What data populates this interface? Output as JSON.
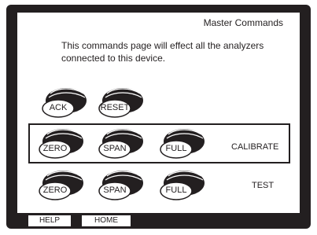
{
  "screen": {
    "title": "Master Commands",
    "description": "This commands page will effect all the analyzers connected to this device."
  },
  "buttons": {
    "ack": "ACK",
    "reset": "RESET",
    "calibrate": {
      "zero": "ZERO",
      "span": "SPAN",
      "full": "FULL",
      "label": "CALIBRATE"
    },
    "test": {
      "zero": "ZERO",
      "span": "SPAN",
      "full": "FULL",
      "label": "TEST"
    }
  },
  "softkeys": {
    "help": "HELP",
    "home": "HOME"
  },
  "colors": {
    "bezel": "#231f20",
    "screen": "#ffffff",
    "ink": "#231f20"
  }
}
